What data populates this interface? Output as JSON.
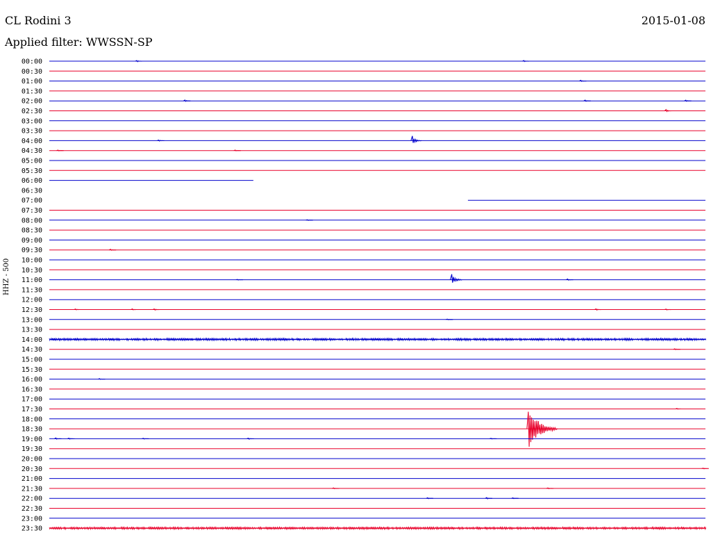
{
  "header": {
    "station": "CL Rodini 3",
    "date": "2015-01-08",
    "filter": "Applied filter: WWSSN-SP"
  },
  "chart_data": {
    "type": "line",
    "ylabel": "HHZ - 500",
    "colors": {
      "even_trace": "#0000cc",
      "odd_trace": "#e8002a"
    },
    "row_labels": [
      "00:00",
      "00:30",
      "01:00",
      "01:30",
      "02:00",
      "02:30",
      "03:00",
      "03:30",
      "04:00",
      "04:30",
      "05:00",
      "05:30",
      "06:00",
      "06:30",
      "07:00",
      "07:30",
      "08:00",
      "08:30",
      "09:00",
      "09:30",
      "10:00",
      "10:30",
      "11:00",
      "11:30",
      "12:00",
      "12:30",
      "13:00",
      "13:30",
      "14:00",
      "14:30",
      "15:00",
      "15:30",
      "16:00",
      "16:30",
      "17:00",
      "17:30",
      "18:00",
      "18:30",
      "19:00",
      "19:30",
      "20:00",
      "20:30",
      "21:00",
      "21:30",
      "22:00",
      "22:30",
      "23:00",
      "23:30"
    ],
    "traces": [
      {
        "row": 0,
        "start": 0,
        "end": 1,
        "events": [
          [
            4.0,
            1.5
          ],
          [
            21.7,
            1.2
          ]
        ]
      },
      {
        "row": 1,
        "start": 0,
        "end": 1,
        "events": []
      },
      {
        "row": 2,
        "start": 0,
        "end": 1,
        "events": [
          [
            24.3,
            1.2
          ]
        ]
      },
      {
        "row": 3,
        "start": 0,
        "end": 1,
        "events": []
      },
      {
        "row": 4,
        "start": 0,
        "end": 1,
        "events": [
          [
            6.2,
            1.5
          ],
          [
            24.5,
            1.2
          ],
          [
            29.1,
            1.5
          ]
        ]
      },
      {
        "row": 5,
        "start": 0,
        "end": 1,
        "events": [
          [
            28.2,
            2.5
          ]
        ]
      },
      {
        "row": 6,
        "start": 0,
        "end": 1,
        "events": []
      },
      {
        "row": 7,
        "start": 0,
        "end": 1,
        "events": []
      },
      {
        "row": 8,
        "start": 0,
        "end": 1,
        "events": [
          [
            5.0,
            1.5
          ],
          [
            16.6,
            7.0
          ]
        ]
      },
      {
        "row": 9,
        "start": 0,
        "end": 1,
        "events": [
          [
            0.4,
            1.0
          ],
          [
            8.5,
            0.8
          ]
        ]
      },
      {
        "row": 10,
        "start": 0,
        "end": 1,
        "events": []
      },
      {
        "row": 11,
        "start": 0,
        "end": 1,
        "events": []
      },
      {
        "row": 12,
        "start": 0,
        "end": 0.311,
        "events": []
      },
      {
        "row": 13,
        "start": 0,
        "end": 0,
        "events": []
      },
      {
        "row": 14,
        "start": 0.638,
        "end": 1,
        "events": []
      },
      {
        "row": 15,
        "start": 0,
        "end": 1,
        "events": []
      },
      {
        "row": 16,
        "start": 0,
        "end": 1,
        "events": [
          [
            11.8,
            0.8
          ]
        ]
      },
      {
        "row": 17,
        "start": 0,
        "end": 1,
        "events": []
      },
      {
        "row": 18,
        "start": 0,
        "end": 1,
        "events": []
      },
      {
        "row": 19,
        "start": 0,
        "end": 1,
        "events": [
          [
            2.8,
            1.2
          ]
        ]
      },
      {
        "row": 20,
        "start": 0,
        "end": 1,
        "events": []
      },
      {
        "row": 21,
        "start": 0,
        "end": 1,
        "events": []
      },
      {
        "row": 22,
        "start": 0,
        "end": 1,
        "events": [
          [
            8.6,
            0.8
          ],
          [
            18.4,
            8.0
          ],
          [
            23.7,
            1.2
          ]
        ]
      },
      {
        "row": 23,
        "start": 0,
        "end": 1,
        "events": []
      },
      {
        "row": 24,
        "start": 0,
        "end": 1,
        "events": []
      },
      {
        "row": 25,
        "start": 0,
        "end": 1,
        "events": [
          [
            1.2,
            1.0
          ],
          [
            3.8,
            1.0
          ],
          [
            4.8,
            1.5
          ],
          [
            25.0,
            1.5
          ],
          [
            28.2,
            1.0
          ]
        ]
      },
      {
        "row": 26,
        "start": 0,
        "end": 1,
        "events": [
          [
            18.2,
            0.8
          ]
        ]
      },
      {
        "row": 27,
        "start": 0,
        "end": 1,
        "events": []
      },
      {
        "row": 28,
        "start": 0,
        "end": 1,
        "events": [],
        "noise": 1.2
      },
      {
        "row": 29,
        "start": 0,
        "end": 1,
        "events": [
          [
            28.6,
            1.0
          ]
        ]
      },
      {
        "row": 30,
        "start": 0,
        "end": 1,
        "events": []
      },
      {
        "row": 31,
        "start": 0,
        "end": 1,
        "events": []
      },
      {
        "row": 32,
        "start": 0,
        "end": 1,
        "events": [
          [
            2.3,
            0.8
          ]
        ]
      },
      {
        "row": 33,
        "start": 0,
        "end": 1,
        "events": []
      },
      {
        "row": 34,
        "start": 0,
        "end": 1,
        "events": []
      },
      {
        "row": 35,
        "start": 0,
        "end": 1,
        "events": [
          [
            28.7,
            0.8
          ]
        ]
      },
      {
        "row": 36,
        "start": 0,
        "end": 1,
        "events": []
      },
      {
        "row": 37,
        "start": 0,
        "end": 1,
        "events": [
          [
            21.9,
            32.0
          ]
        ]
      },
      {
        "row": 38,
        "start": 0,
        "end": 1,
        "events": [
          [
            0.3,
            1.2
          ],
          [
            0.9,
            1.2
          ],
          [
            4.3,
            0.8
          ],
          [
            9.1,
            1.2
          ],
          [
            20.2,
            0.8
          ]
        ]
      },
      {
        "row": 39,
        "start": 0,
        "end": 1,
        "events": []
      },
      {
        "row": 40,
        "start": 0,
        "end": 1,
        "events": []
      },
      {
        "row": 41,
        "start": 0,
        "end": 1,
        "events": [
          [
            29.9,
            0.8
          ]
        ]
      },
      {
        "row": 42,
        "start": 0,
        "end": 1,
        "events": []
      },
      {
        "row": 43,
        "start": 0,
        "end": 1,
        "events": [
          [
            13.0,
            1.0
          ],
          [
            22.8,
            0.8
          ]
        ]
      },
      {
        "row": 44,
        "start": 0,
        "end": 1,
        "events": [
          [
            17.3,
            1.2
          ],
          [
            20.0,
            1.5
          ],
          [
            21.2,
            0.8
          ]
        ]
      },
      {
        "row": 45,
        "start": 0,
        "end": 1,
        "events": []
      },
      {
        "row": 46,
        "start": 0,
        "end": 1,
        "events": []
      },
      {
        "row": 47,
        "start": 0,
        "end": 1,
        "events": [],
        "noise": 1.2
      }
    ]
  }
}
